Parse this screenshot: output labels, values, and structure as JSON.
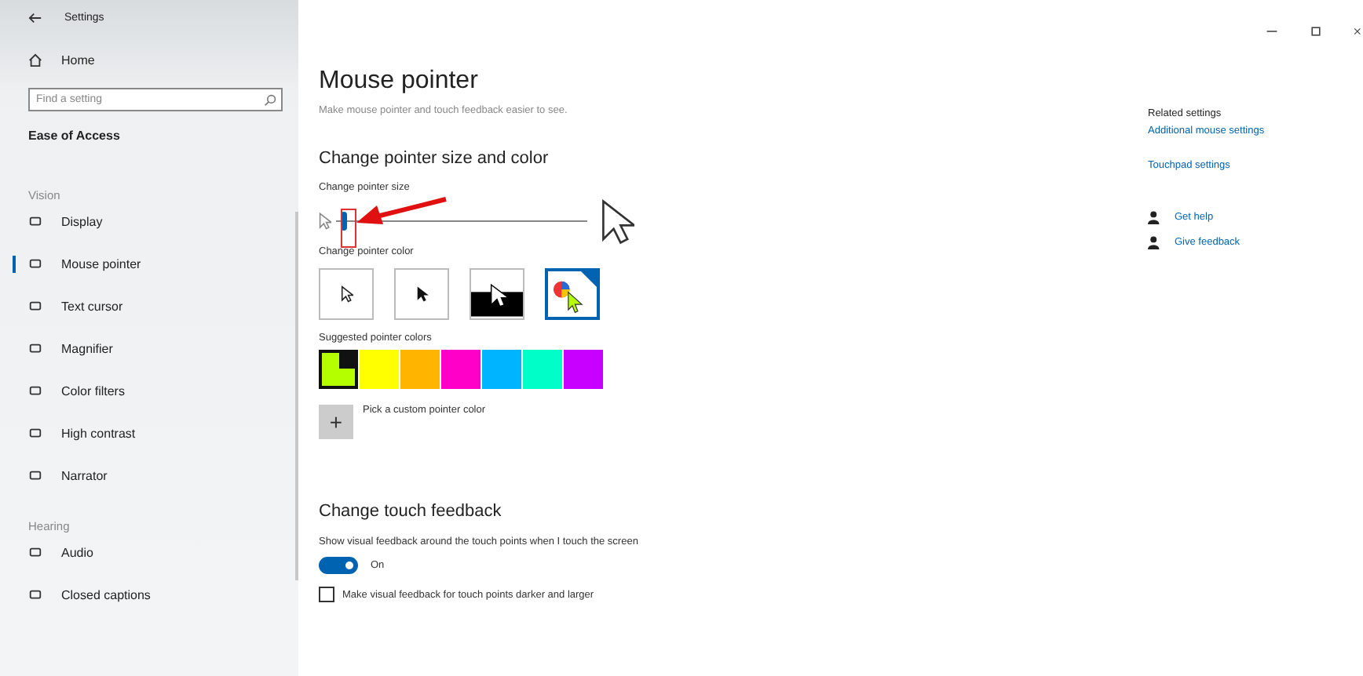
{
  "window": {
    "title": "Settings"
  },
  "sidebar": {
    "home": "Home",
    "search": {
      "placeholder": "Find a setting"
    },
    "heading": "Ease of Access",
    "groups": [
      {
        "label": "Vision",
        "items": [
          {
            "label": "Display",
            "selected": false
          },
          {
            "label": "Mouse pointer",
            "selected": true
          },
          {
            "label": "Text cursor",
            "selected": false
          },
          {
            "label": "Magnifier",
            "selected": false
          },
          {
            "label": "Color filters",
            "selected": false
          },
          {
            "label": "High contrast",
            "selected": false
          },
          {
            "label": "Narrator",
            "selected": false
          }
        ]
      },
      {
        "label": "Hearing",
        "items": [
          {
            "label": "Audio",
            "selected": false
          },
          {
            "label": "Closed captions",
            "selected": false
          }
        ]
      }
    ]
  },
  "page": {
    "title": "Mouse pointer",
    "subtitle": "Make mouse pointer and touch feedback easier to see.",
    "section1": {
      "heading": "Change pointer size and color",
      "size_label": "Change pointer size",
      "size_slider": {
        "level": 0.02
      },
      "color_label": "Change pointer color",
      "color_options": [
        {
          "kind": "white",
          "selected": false
        },
        {
          "kind": "black",
          "selected": false
        },
        {
          "kind": "inverted",
          "selected": false
        },
        {
          "kind": "custom",
          "selected": true
        }
      ],
      "suggested_label": "Suggested pointer colors",
      "suggested": [
        {
          "color": "#b4ff00",
          "selected": true
        },
        {
          "color": "#ffff00",
          "selected": false
        },
        {
          "color": "#ffb400",
          "selected": false
        },
        {
          "color": "#ff00c8",
          "selected": false
        },
        {
          "color": "#00b4ff",
          "selected": false
        },
        {
          "color": "#00ffc8",
          "selected": false
        },
        {
          "color": "#c800ff",
          "selected": false
        }
      ],
      "custom_button": "+",
      "custom_label": "Pick a custom pointer color"
    },
    "section2": {
      "heading": "Change touch feedback",
      "toggle_label": "Show visual feedback around the touch points when I touch the screen",
      "toggle": {
        "on": true,
        "state": "On"
      },
      "checkbox": {
        "label": "Make visual feedback for touch points darker and larger",
        "checked": false
      }
    }
  },
  "related": {
    "heading": "Related settings",
    "links": [
      "Additional mouse settings",
      "Touchpad settings"
    ],
    "help": [
      {
        "label": "Get help"
      },
      {
        "label": "Give feedback"
      }
    ]
  },
  "annotation": {
    "kind": "arrow"
  }
}
